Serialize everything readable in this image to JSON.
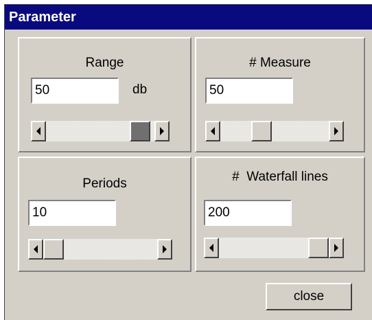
{
  "window": {
    "title": "Parameter"
  },
  "panels": {
    "range": {
      "label": "Range",
      "value": "50",
      "unit": "db",
      "slider_fraction": 0.95,
      "thumb_pressed": true
    },
    "measure": {
      "label": "# Measure",
      "value": "50",
      "slider_fraction": 0.35
    },
    "periods": {
      "label": "Periods",
      "value": "10",
      "slider_fraction": 0.0
    },
    "waterfall": {
      "label": "#  Waterfall lines",
      "value": "200",
      "slider_fraction": 1.0
    }
  },
  "buttons": {
    "close": "close"
  },
  "icons": {
    "scroll_left": "left-arrow-icon",
    "scroll_right": "right-arrow-icon"
  }
}
